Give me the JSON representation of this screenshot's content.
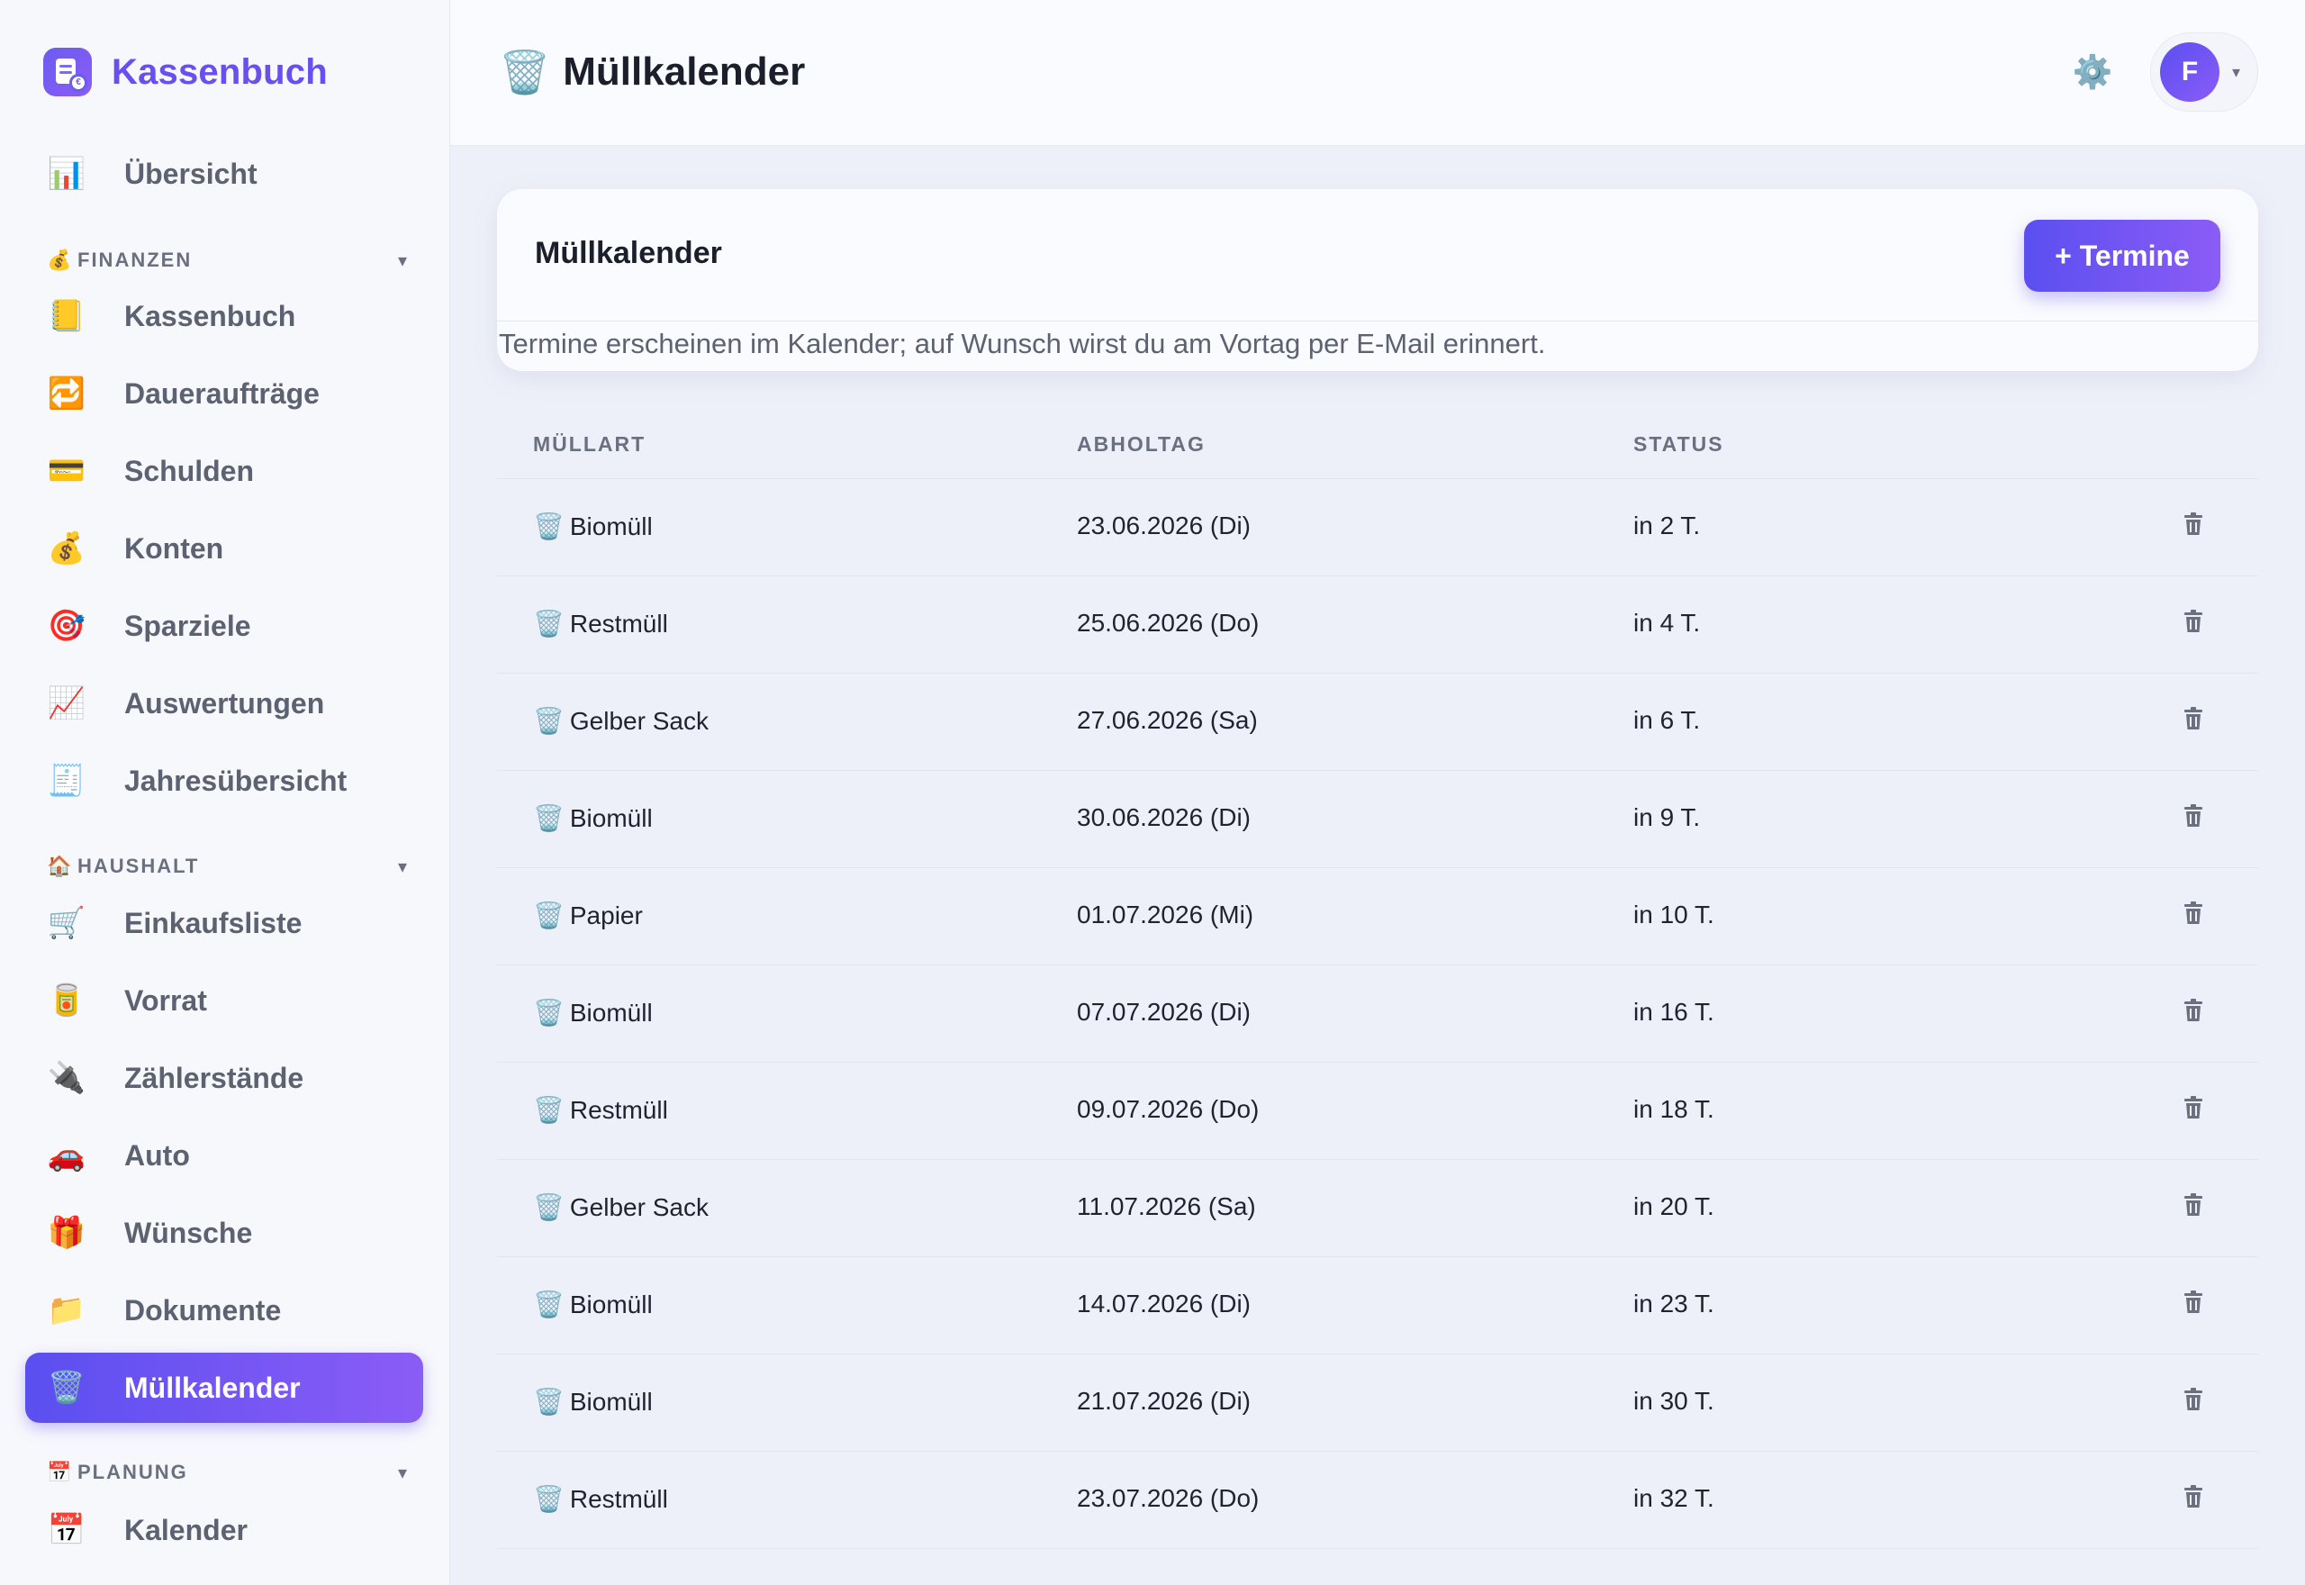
{
  "brand": {
    "name": "Kassenbuch",
    "logo_icon": "ledger-euro-icon"
  },
  "sidebar": {
    "top": {
      "icon": "📊",
      "label": "Übersicht"
    },
    "sections": [
      {
        "icon": "💰",
        "title": "FINANZEN",
        "chevron": "▾",
        "items": [
          {
            "icon": "📒",
            "label": "Kassenbuch"
          },
          {
            "icon": "🔁",
            "label": "Daueraufträge"
          },
          {
            "icon": "💳",
            "label": "Schulden"
          },
          {
            "icon": "💰",
            "label": "Konten"
          },
          {
            "icon": "🎯",
            "label": "Sparziele"
          },
          {
            "icon": "📈",
            "label": "Auswertungen"
          },
          {
            "icon": "🧾",
            "label": "Jahresübersicht"
          }
        ]
      },
      {
        "icon": "🏠",
        "title": "HAUSHALT",
        "chevron": "▾",
        "items": [
          {
            "icon": "🛒",
            "label": "Einkaufsliste"
          },
          {
            "icon": "🥫",
            "label": "Vorrat"
          },
          {
            "icon": "🔌",
            "label": "Zählerstände"
          },
          {
            "icon": "🚗",
            "label": "Auto"
          },
          {
            "icon": "🎁",
            "label": "Wünsche"
          },
          {
            "icon": "📁",
            "label": "Dokumente"
          },
          {
            "icon": "🗑️",
            "label": "Müllkalender",
            "active": true
          }
        ]
      },
      {
        "icon": "📅",
        "title": "PLANUNG",
        "chevron": "▾",
        "items": [
          {
            "icon": "📅",
            "label": "Kalender"
          }
        ]
      }
    ]
  },
  "header": {
    "title_icon": "🗑️",
    "title": "Müllkalender",
    "settings_icon": "⚙️",
    "user_initial": "F",
    "user_chevron": "▾"
  },
  "card": {
    "title": "Müllkalender",
    "add_button": "+ Termine",
    "hint": "Termine erscheinen im Kalender; auf Wunsch wirst du am Vortag per E-Mail erinnert."
  },
  "table": {
    "columns": [
      "MÜLLART",
      "ABHOLTAG",
      "STATUS"
    ],
    "row_icon": "🗑️",
    "rows": [
      {
        "type": "Biomüll",
        "date": "23.06.2026 (Di)",
        "status": "in 2 T."
      },
      {
        "type": "Restmüll",
        "date": "25.06.2026 (Do)",
        "status": "in 4 T."
      },
      {
        "type": "Gelber Sack",
        "date": "27.06.2026 (Sa)",
        "status": "in 6 T."
      },
      {
        "type": "Biomüll",
        "date": "30.06.2026 (Di)",
        "status": "in 9 T."
      },
      {
        "type": "Papier",
        "date": "01.07.2026 (Mi)",
        "status": "in 10 T."
      },
      {
        "type": "Biomüll",
        "date": "07.07.2026 (Di)",
        "status": "in 16 T."
      },
      {
        "type": "Restmüll",
        "date": "09.07.2026 (Do)",
        "status": "in 18 T."
      },
      {
        "type": "Gelber Sack",
        "date": "11.07.2026 (Sa)",
        "status": "in 20 T."
      },
      {
        "type": "Biomüll",
        "date": "14.07.2026 (Di)",
        "status": "in 23 T."
      },
      {
        "type": "Biomüll",
        "date": "21.07.2026 (Di)",
        "status": "in 30 T."
      },
      {
        "type": "Restmüll",
        "date": "23.07.2026 (Do)",
        "status": "in 32 T."
      }
    ]
  },
  "colors": {
    "accent": "#5b4ff0",
    "accent_end": "#8b5cf6",
    "brand_text": "#6a4ff0",
    "background": "#eef0f9"
  }
}
